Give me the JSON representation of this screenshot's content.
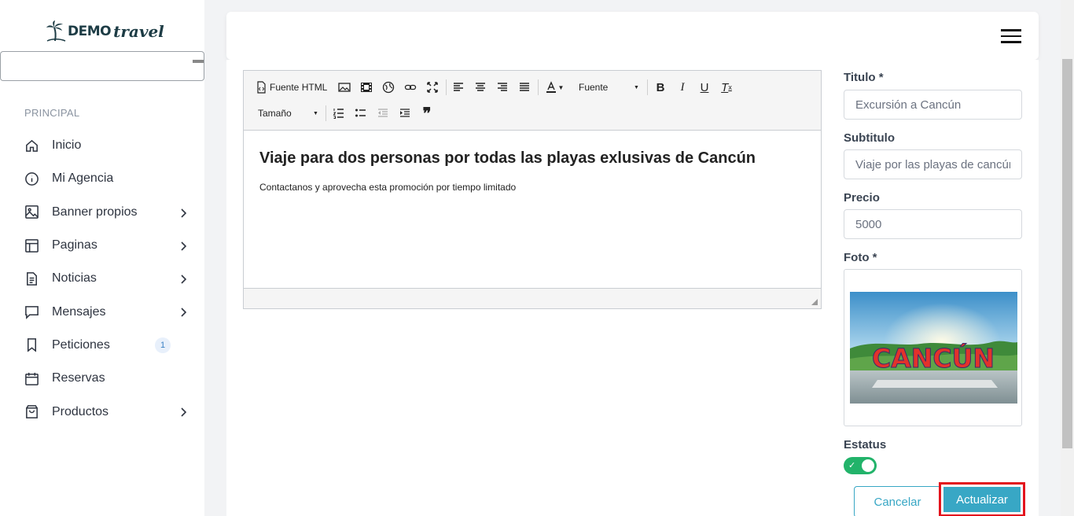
{
  "app": {
    "logo_brand": "DEMO",
    "logo_script": "travel"
  },
  "sidebar": {
    "section_label": "PRINCIPAL",
    "items": [
      {
        "label": "Inicio",
        "icon": "home-icon",
        "chevron": false
      },
      {
        "label": "Mi Agencia",
        "icon": "info-icon",
        "chevron": false
      },
      {
        "label": "Banner propios",
        "icon": "image-icon",
        "chevron": true
      },
      {
        "label": "Paginas",
        "icon": "layout-icon",
        "chevron": true
      },
      {
        "label": "Noticias",
        "icon": "document-icon",
        "chevron": true
      },
      {
        "label": "Mensajes",
        "icon": "message-icon",
        "chevron": true
      },
      {
        "label": "Peticiones",
        "icon": "bookmark-icon",
        "chevron": false,
        "badge": "1"
      },
      {
        "label": "Reservas",
        "icon": "calendar-icon",
        "chevron": false
      },
      {
        "label": "Productos",
        "icon": "shopping-bag-icon",
        "chevron": true
      }
    ]
  },
  "editor": {
    "toolbar": {
      "source_label": "Fuente HTML",
      "font_label": "Fuente",
      "size_label": "Tamaño"
    },
    "heading": "Viaje para dos personas por todas las playas exlusivas de Cancún",
    "paragraph": "Contactanos y aprovecha esta promoción por tiempo limitado"
  },
  "form": {
    "title_label": "Titulo *",
    "title_value": "Excursión a Cancún",
    "subtitle_label": "Subtitulo",
    "subtitle_value": "Viaje por las playas de cancún",
    "price_label": "Precio",
    "price_value": "5000",
    "photo_label": "Foto *",
    "photo_sign_text": "CANCÚN",
    "status_label": "Estatus",
    "status_on": true,
    "cancel_label": "Cancelar",
    "save_label": "Actualizar"
  },
  "colors": {
    "accent": "#38a7c5",
    "toggle_on": "#22b36a",
    "highlight": "#e3141d"
  }
}
